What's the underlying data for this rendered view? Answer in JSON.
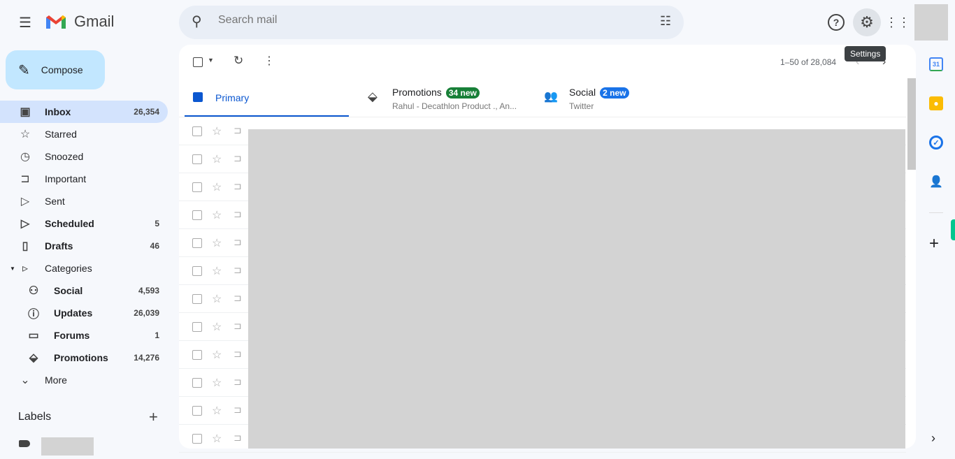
{
  "app": {
    "name": "Gmail"
  },
  "search": {
    "placeholder": "Search mail"
  },
  "header": {
    "tooltip": "Settings"
  },
  "compose": {
    "label": "Compose"
  },
  "sidebar": {
    "items": [
      {
        "label": "Inbox",
        "count": "26,354",
        "icon": "inbox-icon",
        "bold": true
      },
      {
        "label": "Starred",
        "count": "",
        "icon": "star-icon"
      },
      {
        "label": "Snoozed",
        "count": "",
        "icon": "clock-icon"
      },
      {
        "label": "Important",
        "count": "",
        "icon": "important-icon"
      },
      {
        "label": "Sent",
        "count": "",
        "icon": "send-icon"
      },
      {
        "label": "Scheduled",
        "count": "5",
        "icon": "scheduled-icon",
        "bold": true
      },
      {
        "label": "Drafts",
        "count": "46",
        "icon": "draft-icon",
        "bold": true
      },
      {
        "label": "Categories",
        "count": "",
        "icon": "label-icon"
      },
      {
        "label": "Social",
        "count": "4,593",
        "icon": "people-icon",
        "bold": true
      },
      {
        "label": "Updates",
        "count": "26,039",
        "icon": "info-icon",
        "bold": true
      },
      {
        "label": "Forums",
        "count": "1",
        "icon": "forum-icon",
        "bold": true
      },
      {
        "label": "Promotions",
        "count": "14,276",
        "icon": "tag-icon",
        "bold": true
      },
      {
        "label": "More",
        "count": "",
        "icon": "chevron-down-icon"
      }
    ],
    "labels_title": "Labels"
  },
  "toolbar": {
    "pagination": "1–50 of 28,084"
  },
  "tabs": [
    {
      "label": "Primary",
      "active": true
    },
    {
      "label": "Promotions",
      "badge": "34 new",
      "sub": "Rahul - Decathlon Product ., An...",
      "badge_color": "#188038"
    },
    {
      "label": "Social",
      "badge": "2 new",
      "sub": "Twitter",
      "badge_color": "#1a73e8"
    }
  ],
  "colors": {
    "accent": "#0b57d0",
    "compose_bg": "#c2e7ff",
    "active_nav": "#d3e3fd"
  }
}
